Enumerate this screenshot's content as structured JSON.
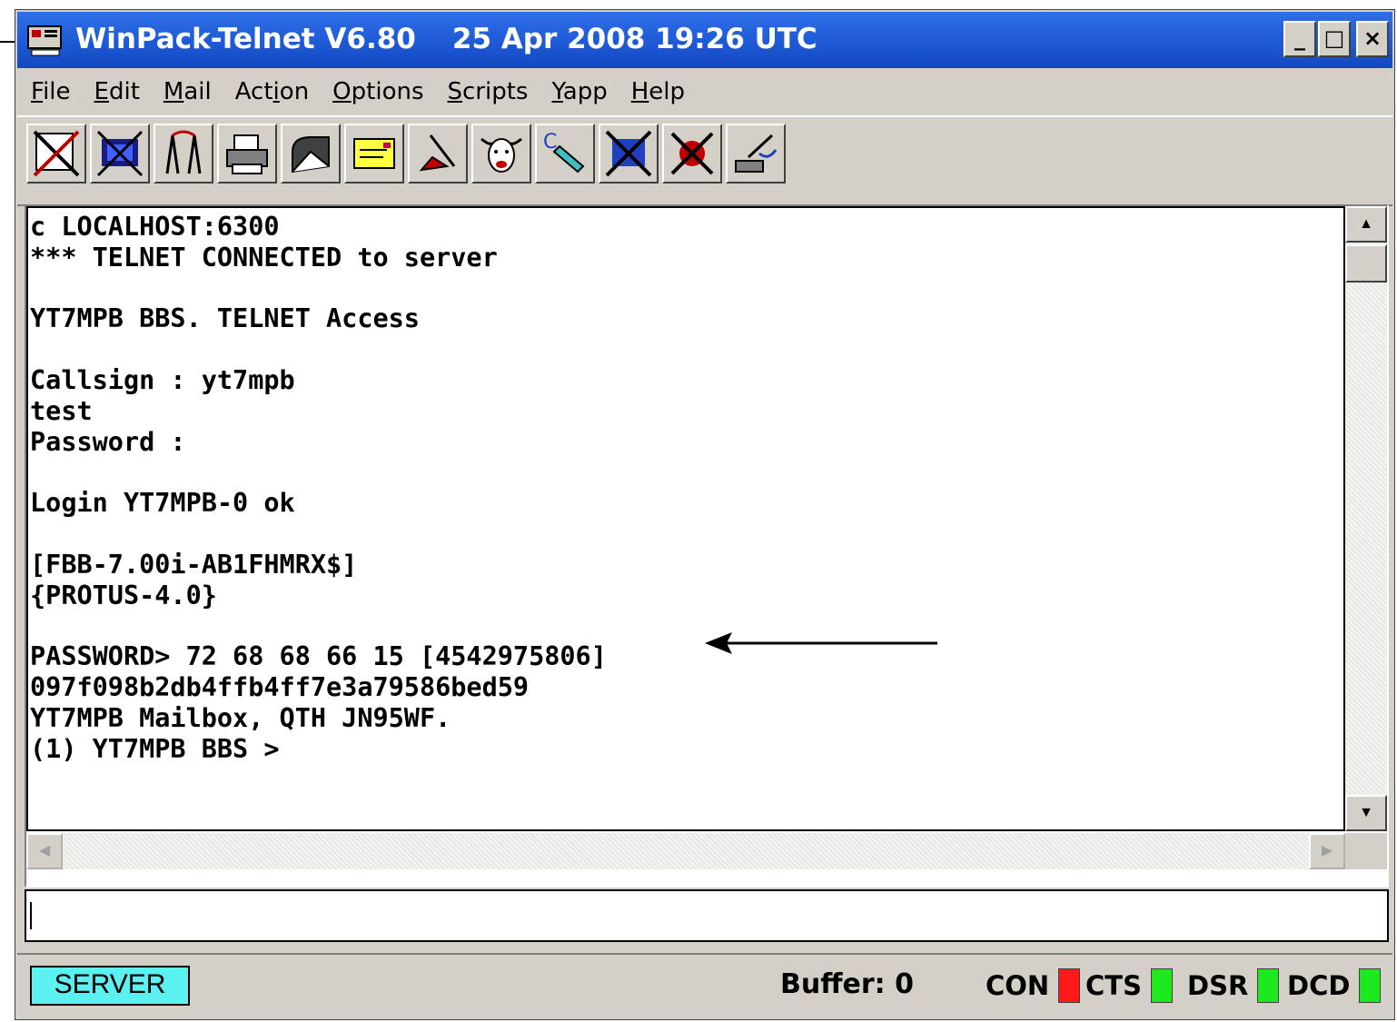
{
  "window": {
    "title": "WinPack-Telnet V6.80",
    "datetime": "25 Apr 2008 19:26 UTC",
    "controls": {
      "minimize": "_",
      "maximize": "□",
      "close": "×"
    }
  },
  "menu": [
    {
      "first": "F",
      "rest": "ile"
    },
    {
      "first": "E",
      "rest": "dit"
    },
    {
      "first": "M",
      "rest": "ail"
    },
    {
      "pre": "Act",
      "first": "i",
      "rest": "on"
    },
    {
      "first": "O",
      "rest": "ptions"
    },
    {
      "first": "S",
      "rest": "cripts"
    },
    {
      "first": "Y",
      "rest": "app"
    },
    {
      "first": "H",
      "rest": "elp"
    }
  ],
  "toolbar": [
    "disconnect-icon",
    "network-icon",
    "antenna-icon",
    "printer-icon",
    "mailbox-icon",
    "message-icon",
    "write-icon",
    "bull-icon",
    "capture-icon",
    "cancel-icon",
    "stop-icon",
    "connect-icon"
  ],
  "terminal": {
    "lines": [
      "c LOCALHOST:6300",
      "*** TELNET CONNECTED to server",
      "",
      "YT7MPB BBS. TELNET Access",
      "",
      "Callsign : yt7mpb",
      "test",
      "Password :",
      "",
      "Login YT7MPB-0 ok",
      "",
      "[FBB-7.00i-AB1FHMRX$]",
      "{PROTUS-4.0}",
      "",
      "PASSWORD> 72 68 68 66 15 [4542975806]",
      "097f098b2db4ffb4ff7e3a79586bed59",
      "YT7MPB Mailbox, QTH JN95WF.",
      "(1) YT7MPB BBS >"
    ]
  },
  "input": {
    "value": ""
  },
  "status": {
    "mode": "SERVER",
    "buffer_label": "Buffer:",
    "buffer_value": "0",
    "indicators": [
      {
        "label": "CON",
        "color": "#ff1a1a"
      },
      {
        "label": "CTS",
        "color": "#1ee81e"
      },
      {
        "label": "DSR",
        "color": "#1ee81e"
      },
      {
        "label": "DCD",
        "color": "#1ee81e"
      }
    ]
  },
  "colors": {
    "titlebar": "#1e5ad6",
    "server_badge": "#5cf0f0",
    "led_red": "#ff1a1a",
    "led_green": "#1ee81e"
  }
}
